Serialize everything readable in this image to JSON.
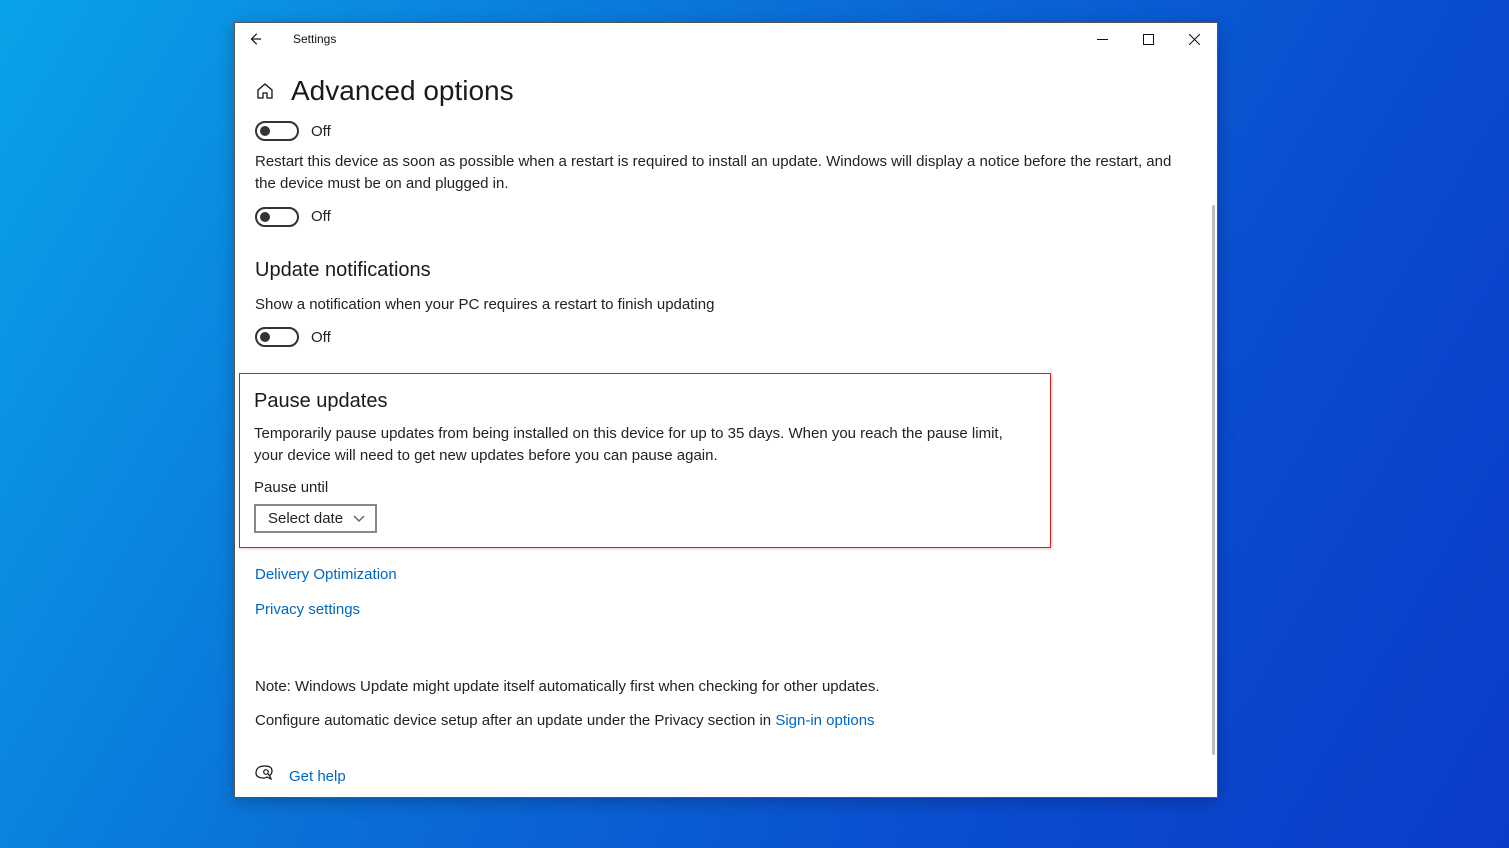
{
  "titlebar": {
    "app_name": "Settings"
  },
  "page": {
    "title": "Advanced options",
    "toggle1_state": "Off",
    "restart_text": "Restart this device as soon as possible when a restart is required to install an update. Windows will display a notice before the restart, and the device must be on and plugged in.",
    "toggle2_state": "Off"
  },
  "notifications": {
    "heading": "Update notifications",
    "text": "Show a notification when your PC requires a restart to finish updating",
    "toggle_state": "Off"
  },
  "pause": {
    "heading": "Pause updates",
    "text": "Temporarily pause updates from being installed on this device for up to 35 days. When you reach the pause limit, your device will need to get new updates before you can pause again.",
    "until_label": "Pause until",
    "dropdown_value": "Select date"
  },
  "links": {
    "delivery": "Delivery Optimization",
    "privacy": "Privacy settings"
  },
  "footer": {
    "note": "Note: Windows Update might update itself automatically first when checking for other updates.",
    "configure_prefix": "Configure automatic device setup after an update under the Privacy section in ",
    "signin_link": "Sign-in options",
    "gethelp": "Get help"
  }
}
